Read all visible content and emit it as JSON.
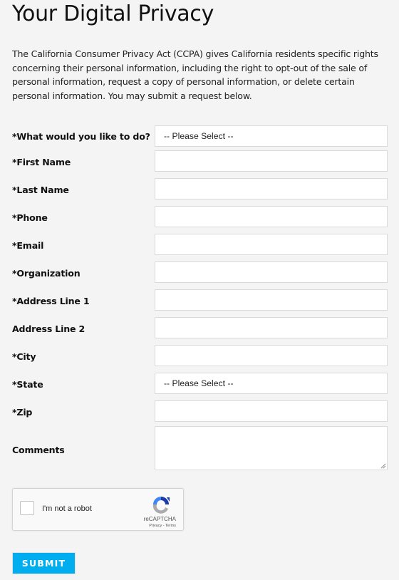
{
  "page": {
    "title": "Your Digital Privacy",
    "intro": "The California Consumer Privacy Act (CCPA) gives California residents specific rights concerning their personal information, including the right to opt-out of the sale of personal information, request a copy of personal information, or delete certain personal information. You may submit a request below."
  },
  "form": {
    "fields": [
      {
        "label": "*What would you like to do?",
        "type": "select",
        "value": "-- Please Select --"
      },
      {
        "label": "*First Name",
        "type": "text",
        "value": ""
      },
      {
        "label": "*Last Name",
        "type": "text",
        "value": ""
      },
      {
        "label": "*Phone",
        "type": "text",
        "value": ""
      },
      {
        "label": "*Email",
        "type": "text",
        "value": ""
      },
      {
        "label": "*Organization",
        "type": "text",
        "value": ""
      },
      {
        "label": "*Address Line 1",
        "type": "text",
        "value": ""
      },
      {
        "label": "Address Line 2",
        "type": "text",
        "value": ""
      },
      {
        "label": "*City",
        "type": "text",
        "value": ""
      },
      {
        "label": "*State",
        "type": "select",
        "value": "-- Please Select --"
      },
      {
        "label": "*Zip",
        "type": "text",
        "value": ""
      },
      {
        "label": "Comments",
        "type": "textarea",
        "value": ""
      }
    ],
    "captcha": {
      "label": "I'm not a robot",
      "brand": "reCAPTCHA",
      "links": "Privacy - Terms",
      "checked": false
    },
    "submit_label": "SUBMIT"
  },
  "colors": {
    "background": "#f4f4f4",
    "submit": "#00aeef",
    "field_border": "#dadada"
  }
}
